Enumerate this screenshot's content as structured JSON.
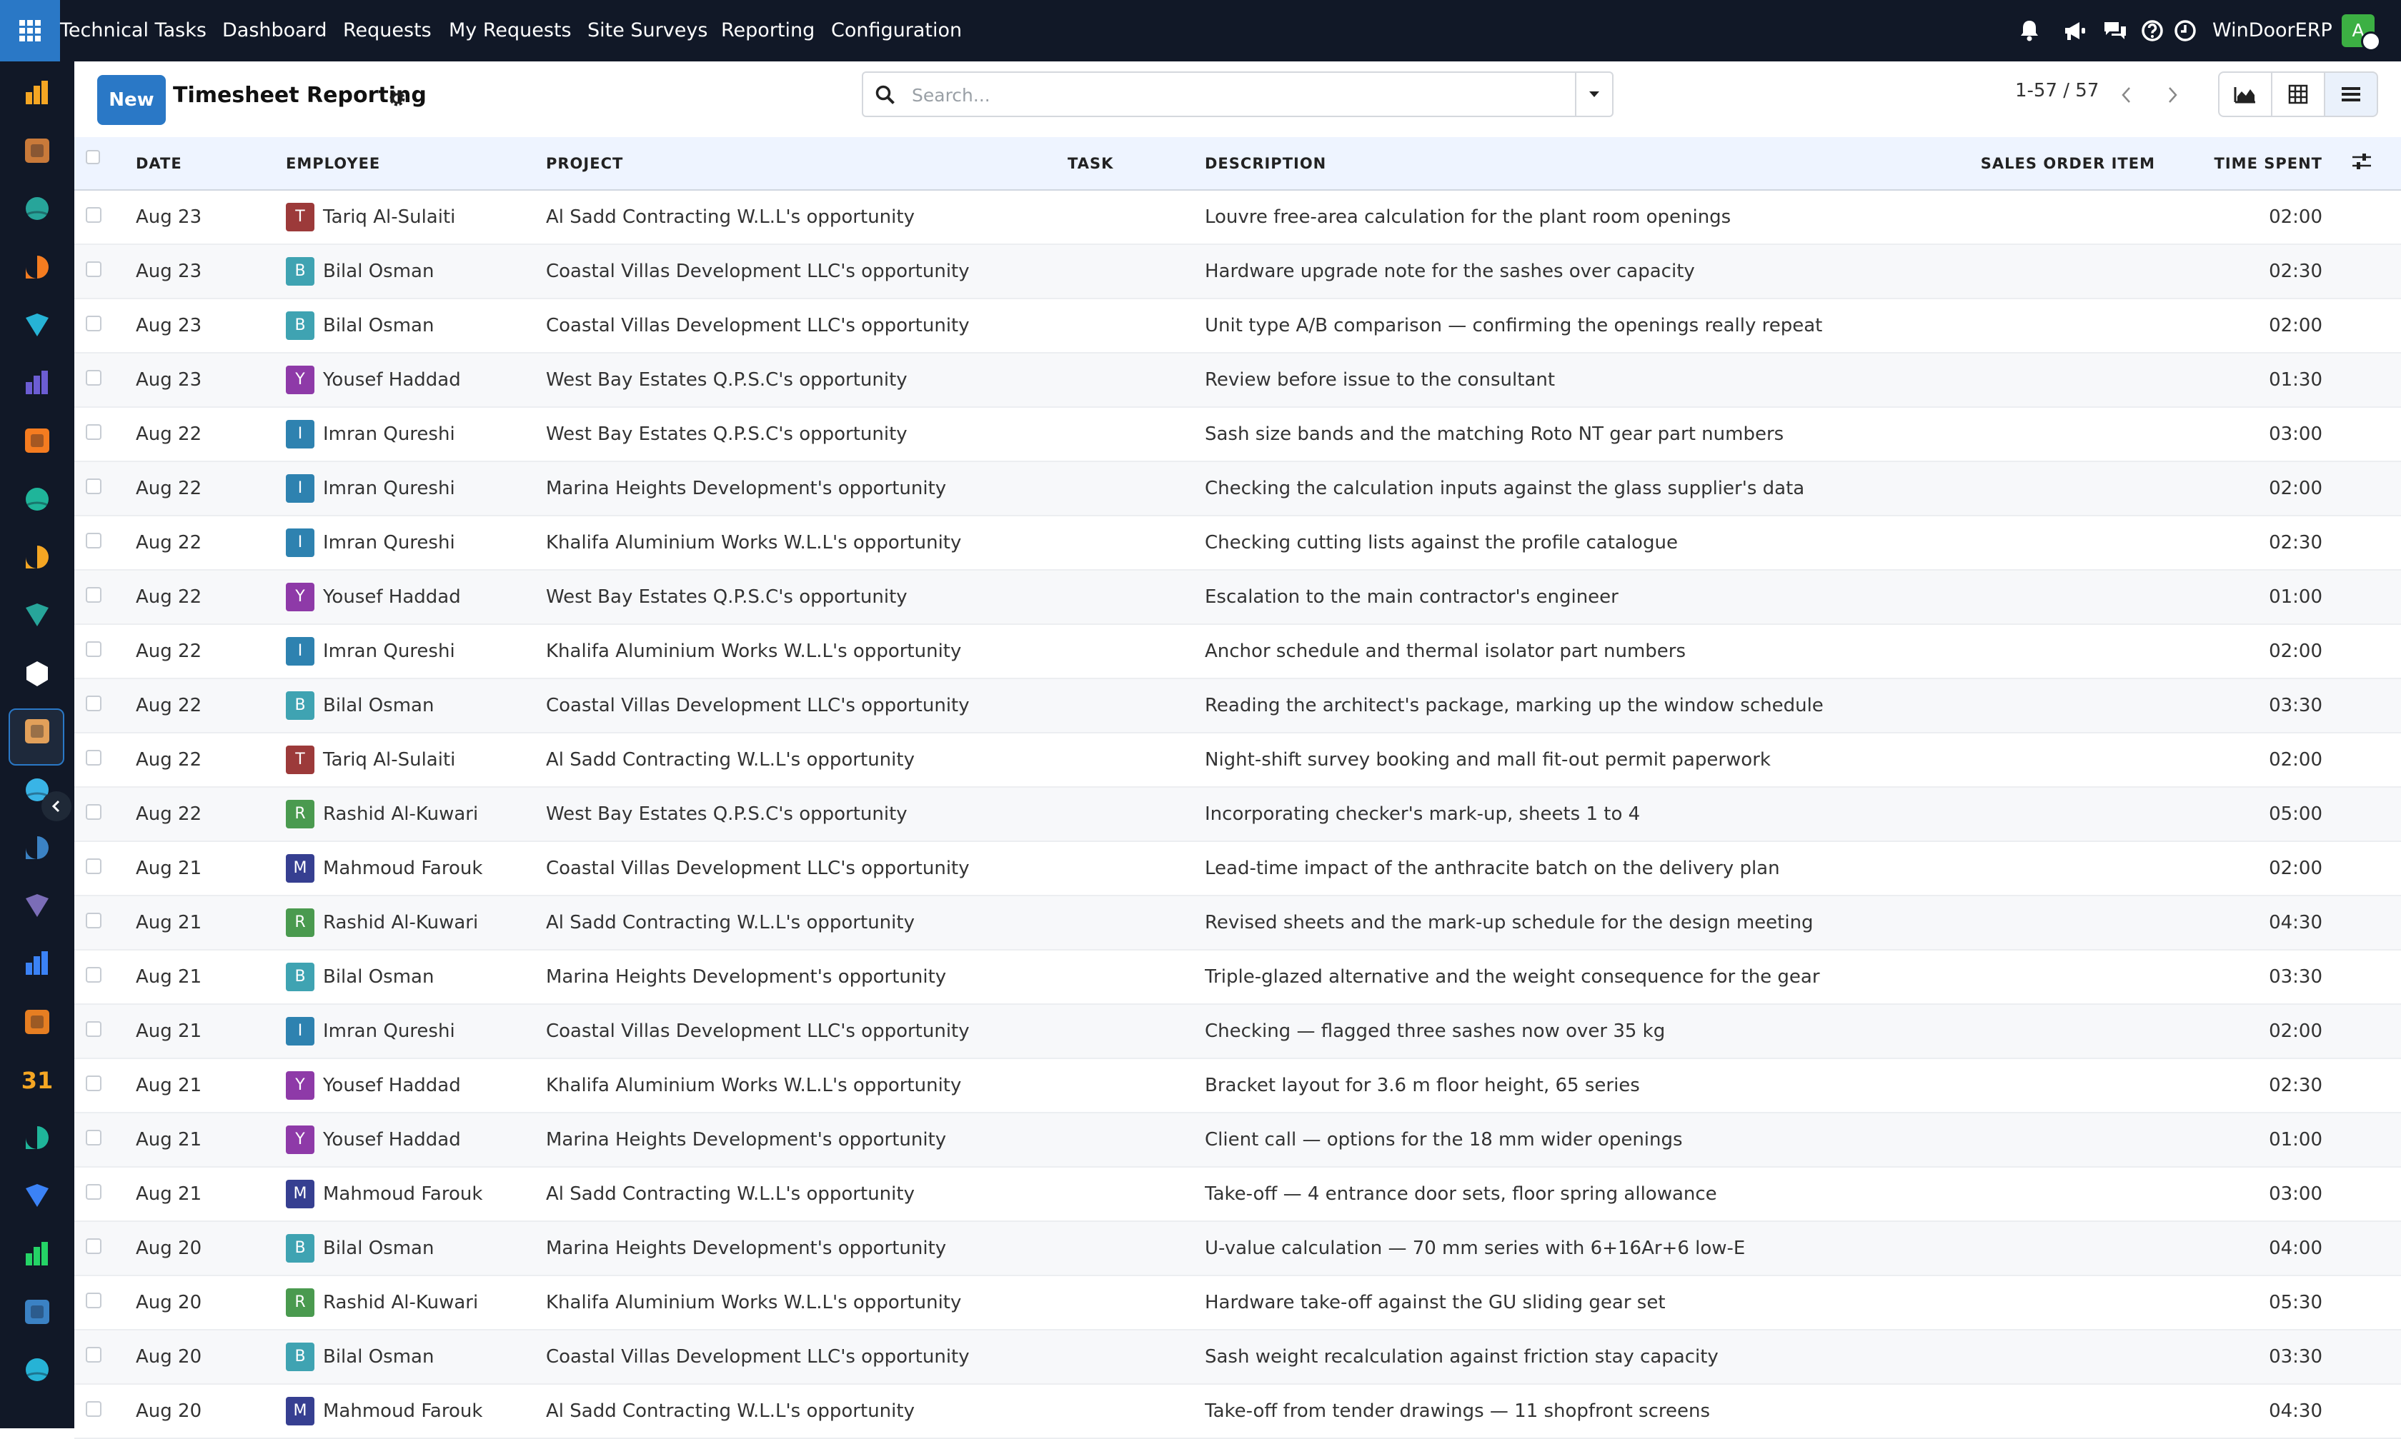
{
  "topbar": {
    "app_name": "Technical Tasks",
    "menu": [
      "Dashboard",
      "Requests",
      "My Requests",
      "Site Surveys",
      "Reporting",
      "Configuration"
    ],
    "company": "WinDoorERP",
    "user_initial": "A"
  },
  "control": {
    "new_label": "New",
    "title": "Timesheet Reporting",
    "search_placeholder": "Search...",
    "pager": "1-57 / 57"
  },
  "table": {
    "columns": [
      "DATE",
      "EMPLOYEE",
      "PROJECT",
      "TASK",
      "DESCRIPTION",
      "SALES ORDER ITEM",
      "TIME SPENT"
    ],
    "employees": {
      "Tariq Al-Sulaiti": {
        "initial": "T",
        "color": "#9c3a3a"
      },
      "Bilal Osman": {
        "initial": "B",
        "color": "#3fa3b2"
      },
      "Yousef Haddad": {
        "initial": "Y",
        "color": "#8e3aa8"
      },
      "Imran Qureshi": {
        "initial": "I",
        "color": "#2e82b0"
      },
      "Rashid Al-Kuwari": {
        "initial": "R",
        "color": "#4a9a4f"
      },
      "Mahmoud Farouk": {
        "initial": "M",
        "color": "#363f91"
      }
    },
    "rows": [
      {
        "date": "Aug 23",
        "employee": "Tariq Al-Sulaiti",
        "project": "Al Sadd Contracting W.L.L's opportunity",
        "task": "",
        "description": "Louvre free-area calculation for the plant room openings",
        "sales_order_item": "",
        "time": "02:00"
      },
      {
        "date": "Aug 23",
        "employee": "Bilal Osman",
        "project": "Coastal Villas Development LLC's opportunity",
        "task": "",
        "description": "Hardware upgrade note for the sashes over capacity",
        "sales_order_item": "",
        "time": "02:30"
      },
      {
        "date": "Aug 23",
        "employee": "Bilal Osman",
        "project": "Coastal Villas Development LLC's opportunity",
        "task": "",
        "description": "Unit type A/B comparison — confirming the openings really repeat",
        "sales_order_item": "",
        "time": "02:00"
      },
      {
        "date": "Aug 23",
        "employee": "Yousef Haddad",
        "project": "West Bay Estates Q.P.S.C's opportunity",
        "task": "",
        "description": "Review before issue to the consultant",
        "sales_order_item": "",
        "time": "01:30"
      },
      {
        "date": "Aug 22",
        "employee": "Imran Qureshi",
        "project": "West Bay Estates Q.P.S.C's opportunity",
        "task": "",
        "description": "Sash size bands and the matching Roto NT gear part numbers",
        "sales_order_item": "",
        "time": "03:00"
      },
      {
        "date": "Aug 22",
        "employee": "Imran Qureshi",
        "project": "Marina Heights Development's opportunity",
        "task": "",
        "description": "Checking the calculation inputs against the glass supplier's data",
        "sales_order_item": "",
        "time": "02:00"
      },
      {
        "date": "Aug 22",
        "employee": "Imran Qureshi",
        "project": "Khalifa Aluminium Works W.L.L's opportunity",
        "task": "",
        "description": "Checking cutting lists against the profile catalogue",
        "sales_order_item": "",
        "time": "02:30"
      },
      {
        "date": "Aug 22",
        "employee": "Yousef Haddad",
        "project": "West Bay Estates Q.P.S.C's opportunity",
        "task": "",
        "description": "Escalation to the main contractor's engineer",
        "sales_order_item": "",
        "time": "01:00"
      },
      {
        "date": "Aug 22",
        "employee": "Imran Qureshi",
        "project": "Khalifa Aluminium Works W.L.L's opportunity",
        "task": "",
        "description": "Anchor schedule and thermal isolator part numbers",
        "sales_order_item": "",
        "time": "02:00"
      },
      {
        "date": "Aug 22",
        "employee": "Bilal Osman",
        "project": "Coastal Villas Development LLC's opportunity",
        "task": "",
        "description": "Reading the architect's package, marking up the window schedule",
        "sales_order_item": "",
        "time": "03:30"
      },
      {
        "date": "Aug 22",
        "employee": "Tariq Al-Sulaiti",
        "project": "Al Sadd Contracting W.L.L's opportunity",
        "task": "",
        "description": "Night-shift survey booking and mall fit-out permit paperwork",
        "sales_order_item": "",
        "time": "02:00"
      },
      {
        "date": "Aug 22",
        "employee": "Rashid Al-Kuwari",
        "project": "West Bay Estates Q.P.S.C's opportunity",
        "task": "",
        "description": "Incorporating checker's mark-up, sheets 1 to 4",
        "sales_order_item": "",
        "time": "05:00"
      },
      {
        "date": "Aug 21",
        "employee": "Mahmoud Farouk",
        "project": "Coastal Villas Development LLC's opportunity",
        "task": "",
        "description": "Lead-time impact of the anthracite batch on the delivery plan",
        "sales_order_item": "",
        "time": "02:00"
      },
      {
        "date": "Aug 21",
        "employee": "Rashid Al-Kuwari",
        "project": "Al Sadd Contracting W.L.L's opportunity",
        "task": "",
        "description": "Revised sheets and the mark-up schedule for the design meeting",
        "sales_order_item": "",
        "time": "04:30"
      },
      {
        "date": "Aug 21",
        "employee": "Bilal Osman",
        "project": "Marina Heights Development's opportunity",
        "task": "",
        "description": "Triple-glazed alternative and the weight consequence for the gear",
        "sales_order_item": "",
        "time": "03:30"
      },
      {
        "date": "Aug 21",
        "employee": "Imran Qureshi",
        "project": "Coastal Villas Development LLC's opportunity",
        "task": "",
        "description": "Checking — flagged three sashes now over 35 kg",
        "sales_order_item": "",
        "time": "02:00"
      },
      {
        "date": "Aug 21",
        "employee": "Yousef Haddad",
        "project": "Khalifa Aluminium Works W.L.L's opportunity",
        "task": "",
        "description": "Bracket layout for 3.6 m floor height, 65 series",
        "sales_order_item": "",
        "time": "02:30"
      },
      {
        "date": "Aug 21",
        "employee": "Yousef Haddad",
        "project": "Marina Heights Development's opportunity",
        "task": "",
        "description": "Client call — options for the 18 mm wider openings",
        "sales_order_item": "",
        "time": "01:00"
      },
      {
        "date": "Aug 21",
        "employee": "Mahmoud Farouk",
        "project": "Al Sadd Contracting W.L.L's opportunity",
        "task": "",
        "description": "Take-off — 4 entrance door sets, floor spring allowance",
        "sales_order_item": "",
        "time": "03:00"
      },
      {
        "date": "Aug 20",
        "employee": "Bilal Osman",
        "project": "Marina Heights Development's opportunity",
        "task": "",
        "description": "U-value calculation — 70 mm series with 6+16Ar+6 low-E",
        "sales_order_item": "",
        "time": "04:00"
      },
      {
        "date": "Aug 20",
        "employee": "Rashid Al-Kuwari",
        "project": "Khalifa Aluminium Works W.L.L's opportunity",
        "task": "",
        "description": "Hardware take-off against the GU sliding gear set",
        "sales_order_item": "",
        "time": "05:30"
      },
      {
        "date": "Aug 20",
        "employee": "Bilal Osman",
        "project": "Coastal Villas Development LLC's opportunity",
        "task": "",
        "description": "Sash weight recalculation against friction stay capacity",
        "sales_order_item": "",
        "time": "03:30"
      },
      {
        "date": "Aug 20",
        "employee": "Mahmoud Farouk",
        "project": "Al Sadd Contracting W.L.L's opportunity",
        "task": "",
        "description": "Take-off from tender drawings — 11 shopfront screens",
        "sales_order_item": "",
        "time": "04:30"
      }
    ]
  },
  "sidebar": {
    "icons": [
      "sales-icon",
      "tasks-icon",
      "contacts-icon",
      "discuss-icon",
      "website-icon",
      "email-marketing-icon",
      "chat-icon",
      "forms-icon",
      "reporting-icon",
      "employees-icon",
      "technical-tasks-icon",
      "projects-icon",
      "todo-icon",
      "knowledge-icon",
      "inventory-icon",
      "invoicing-icon",
      "team-icon",
      "calendar-icon",
      "sign-icon",
      "dashboards-icon",
      "whatsapp-icon",
      "timer-icon",
      "live-chat-icon"
    ],
    "colors": [
      "#f5a623",
      "#c97a3a",
      "#27a59a",
      "#f57c20",
      "#26b3d6",
      "#6c5dd3",
      "#f57c20",
      "#1fb59a",
      "#f5a623",
      "#27a59a",
      "#ffffff",
      "#e2a05a",
      "#39b4e6",
      "#3b82c4",
      "#7b6db7",
      "#3b82f6",
      "#e67e22",
      "#f5a623",
      "#1fb59a",
      "#3b82f6",
      "#25d366",
      "#3b82c4",
      "#26b3d6"
    ]
  }
}
